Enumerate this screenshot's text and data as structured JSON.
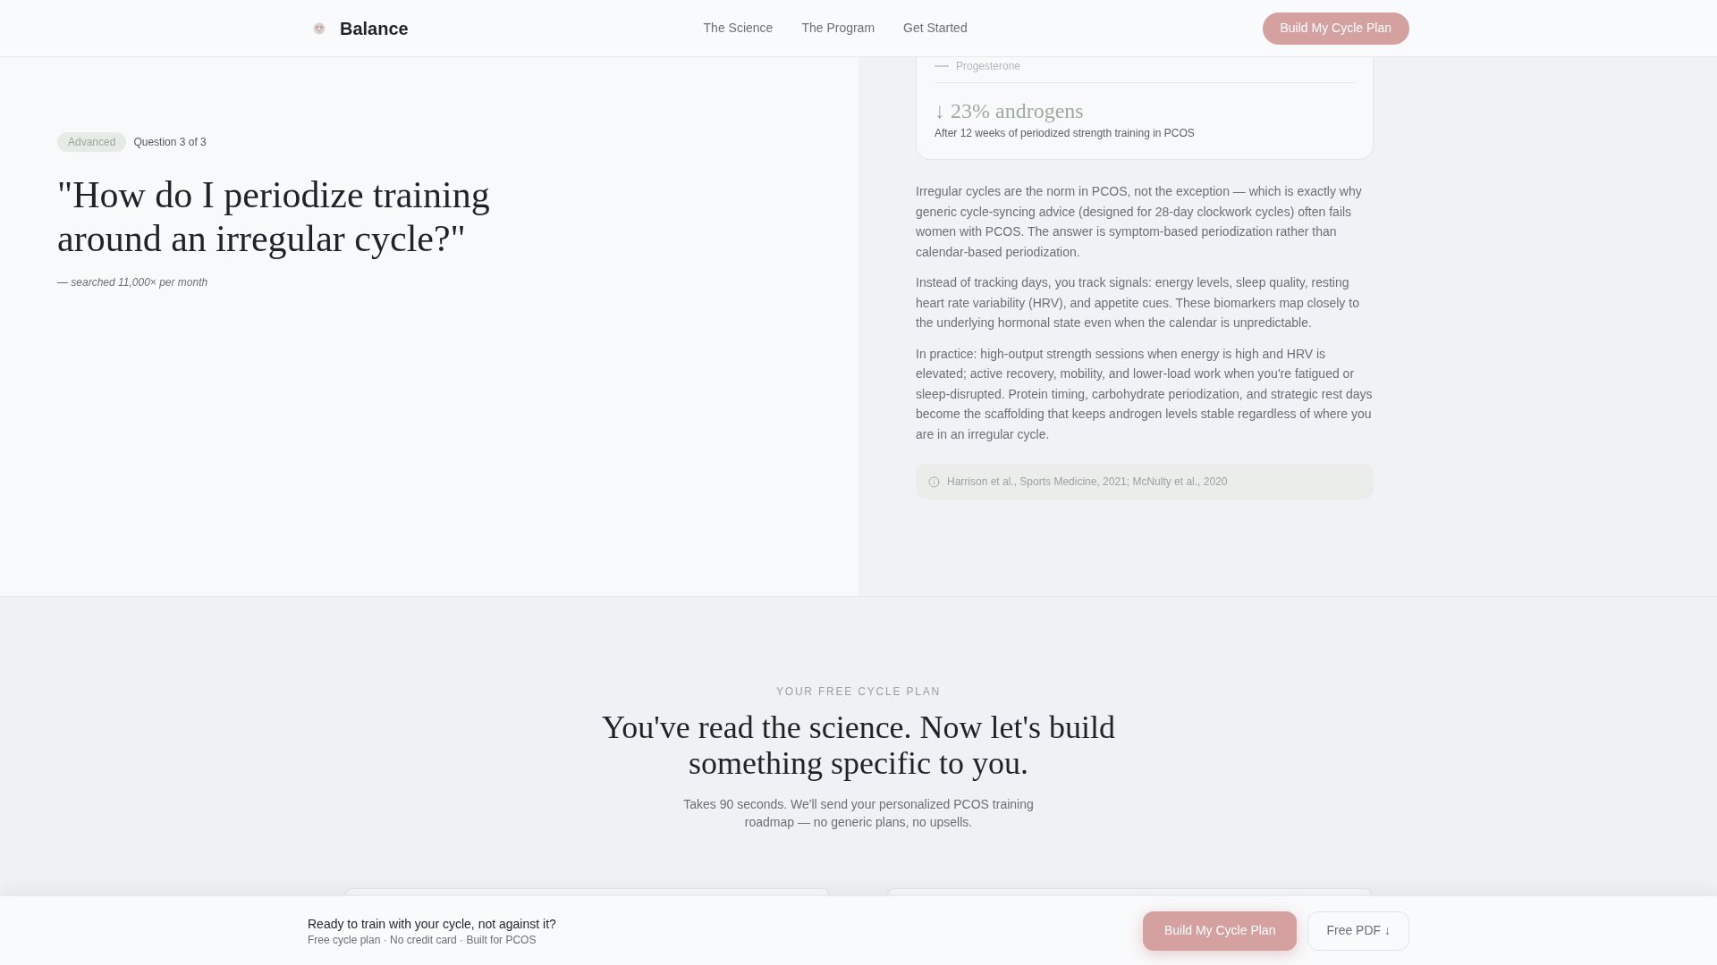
{
  "header": {
    "logo": "Balance",
    "nav": [
      {
        "label": "The Science"
      },
      {
        "label": "The Program"
      },
      {
        "label": "Get Started"
      }
    ],
    "cta": "Build My Cycle Plan"
  },
  "question": {
    "badge": "Advanced",
    "counter": "Question 3 of 3",
    "title": "\"How do I periodize training around an irregular cycle?\"",
    "meta": "— searched 11,000× per month"
  },
  "answer": {
    "chart_legend": [
      {
        "label": "Progesterone"
      }
    ],
    "stat": "↓ 23% androgens",
    "stat_caption": "After 12 weeks of periodized strength training in PCOS",
    "paragraphs": [
      "Irregular cycles are the norm in PCOS, not the exception — which is exactly why generic cycle-syncing advice (designed for 28-day clockwork cycles) often fails women with PCOS. The answer is symptom-based periodization rather than calendar-based periodization.",
      "Instead of tracking days, you track signals: energy levels, sleep quality, resting heart rate variability (HRV), and appetite cues. These biomarkers map closely to the underlying hormonal state even when the calendar is unpredictable.",
      "In practice: high-output strength sessions when energy is high and HRV is elevated; active recovery, mobility, and lower-load work when you're fatigued or sleep-disrupted. Protein timing, carbohydrate periodization, and strategic rest days become the scaffolding that keeps androgen levels stable regardless of where you are in an irregular cycle."
    ],
    "citation": "Harrison et al., Sports Medicine, 2021; McNulty et al., 2020"
  },
  "plan_section": {
    "eyebrow": "YOUR FREE CYCLE PLAN",
    "title": "You've read the science. Now let's build something specific to you.",
    "subtitle": "Takes 90 seconds. We'll send your personalized PCOS training roadmap — no generic plans, no upsells."
  },
  "sticky_bar": {
    "title": "Ready to train with your cycle, not against it?",
    "subtitle": "Free cycle plan · No credit card · Built for PCOS",
    "buttons": [
      {
        "label": "Build My Cycle Plan",
        "kind": "primary"
      },
      {
        "label": "Free PDF ↓",
        "kind": "secondary"
      }
    ]
  }
}
